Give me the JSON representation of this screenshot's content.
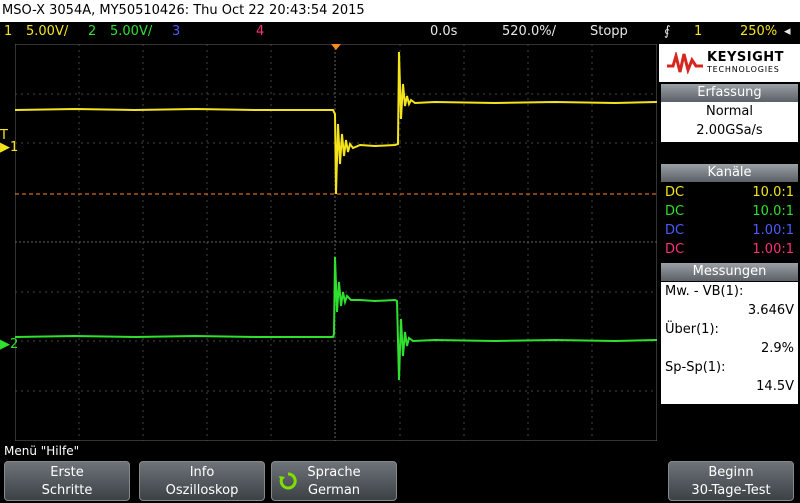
{
  "title": "MSO-X 3054A, MY50510426: Thu Oct 22 20:43:54 2015",
  "status": {
    "ch1_num": "1",
    "ch1_scale": "5.00V/",
    "ch2_num": "2",
    "ch2_scale": "5.00V/",
    "ch3_num": "3",
    "ch4_num": "4",
    "time_offset": "0.0s",
    "time_scale": "520.0%/",
    "run_state": "Stopp",
    "trigger_source": "1",
    "trigger_level": "250%"
  },
  "logo": {
    "brand": "KEYSIGHT",
    "sub": "TECHNOLOGIES"
  },
  "acquisition": {
    "header": "Erfassung",
    "mode": "Normal",
    "rate": "2.00GSa/s"
  },
  "channels": {
    "header": "Kanäle",
    "rows": [
      {
        "coupling": "DC",
        "probe": "10.0:1",
        "color": "#f4e41c"
      },
      {
        "coupling": "DC",
        "probe": "10.0:1",
        "color": "#2fe02f"
      },
      {
        "coupling": "DC",
        "probe": "1.00:1",
        "color": "#4b5cff"
      },
      {
        "coupling": "DC",
        "probe": "1.00:1",
        "color": "#ff2f7a"
      }
    ]
  },
  "measurements": {
    "header": "Messungen",
    "items": [
      {
        "label": "Mw. - VB(1):",
        "value": "3.646V"
      },
      {
        "label": "Über(1):",
        "value": "2.9%"
      },
      {
        "label": "Sp-Sp(1):",
        "value": "14.5V"
      }
    ]
  },
  "markers": {
    "ch1_label": "1",
    "ch2_label": "2",
    "trig_label": "T"
  },
  "menu_title": "Menü \"Hilfe\"",
  "softkeys": [
    {
      "line1": "Erste",
      "line2": "Schritte"
    },
    {
      "line1": "Info",
      "line2": "Oszilloskop"
    },
    {
      "line1": "Sprache",
      "line2": "German"
    },
    {
      "line1": "Beginn",
      "line2": "30-Tage-Test"
    }
  ],
  "colors": {
    "ch1": "#f4e41c",
    "ch2": "#2fe02f",
    "ch3": "#4b5cff",
    "ch4": "#ff2f7a",
    "trigger_orange": "#ff8a1c"
  }
}
